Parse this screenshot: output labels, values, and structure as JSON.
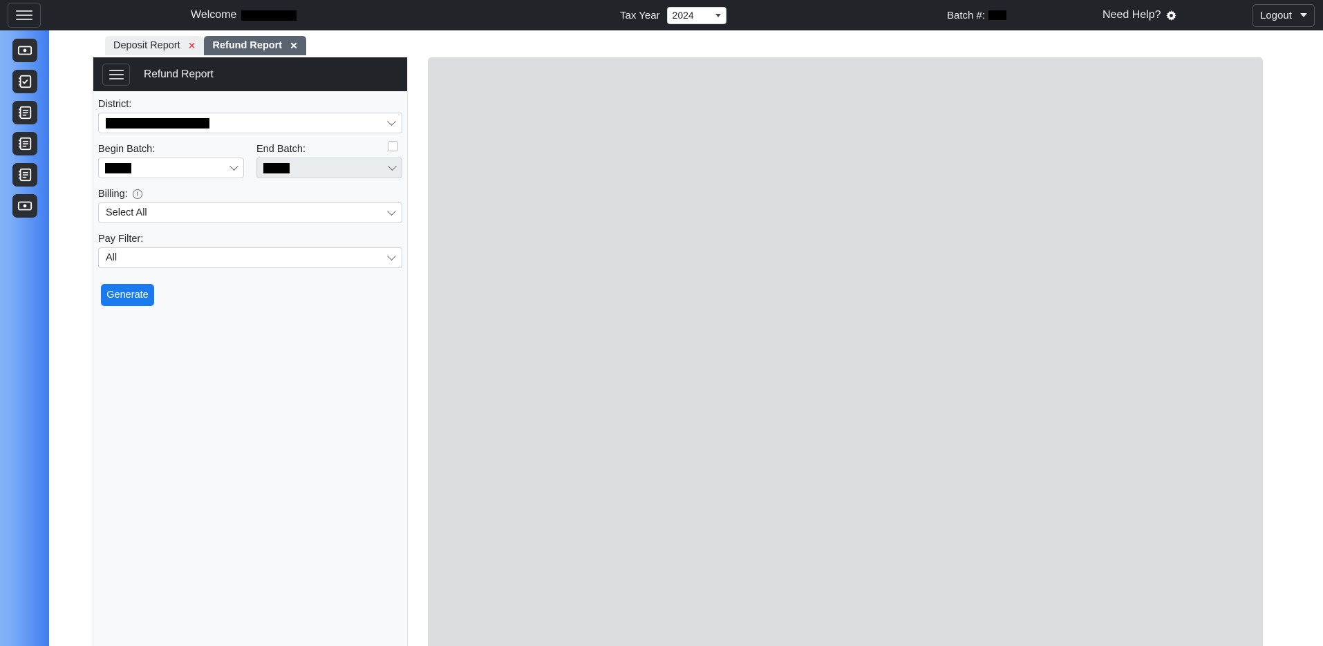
{
  "topbar": {
    "menu_icon": "hamburger-icon",
    "welcome_label": "Welcome",
    "welcome_value_redacted": true,
    "tax_year_label": "Tax Year",
    "tax_year_value": "2024",
    "tax_year_options": [
      "2024"
    ],
    "batch_label": "Batch #:",
    "batch_value_redacted": true,
    "help_label": "Need Help?",
    "help_icon": "gear-icon",
    "logout_label": "Logout",
    "logout_caret_icon": "caret-down-icon",
    "background_color": "#212529"
  },
  "rail": {
    "gradient_from": "#84b2f8",
    "gradient_to": "#3f7df0",
    "items": [
      {
        "name": "cash-report",
        "icon": "money-bill-icon"
      },
      {
        "name": "checklist-report",
        "icon": "clipboard-check-icon"
      },
      {
        "name": "list-report-1",
        "icon": "document-list-icon"
      },
      {
        "name": "list-report-2",
        "icon": "document-list-icon"
      },
      {
        "name": "list-report-3",
        "icon": "document-list-icon"
      },
      {
        "name": "deposit-report",
        "icon": "money-bill-icon"
      }
    ]
  },
  "tabs": [
    {
      "label": "Deposit Report",
      "active": false,
      "close_icon": "close-icon"
    },
    {
      "label": "Refund Report",
      "active": true,
      "close_icon": "close-icon"
    }
  ],
  "panel": {
    "menu_icon": "hamburger-icon",
    "title": "Refund Report",
    "header_background": "#212529",
    "fields": {
      "district": {
        "label": "District:",
        "value_redacted": true,
        "chevron_icon": "chevron-down-icon"
      },
      "begin_batch": {
        "label": "Begin Batch:",
        "value_redacted": true,
        "chevron_icon": "chevron-down-icon"
      },
      "end_batch": {
        "label": "End Batch:",
        "value_redacted": true,
        "disabled": true,
        "checkbox_checked": false,
        "chevron_icon": "chevron-down-icon"
      },
      "billing": {
        "label": "Billing:",
        "info_icon": "info-circle-icon",
        "info_glyph": "i",
        "value": "Select All",
        "chevron_icon": "chevron-down-icon"
      },
      "pay_filter": {
        "label": "Pay Filter:",
        "value": "All",
        "chevron_icon": "chevron-down-icon"
      }
    },
    "generate_label": "Generate",
    "generate_color": "#1b7aed"
  },
  "content": {
    "empty": true,
    "background_color": "#dadcde"
  }
}
